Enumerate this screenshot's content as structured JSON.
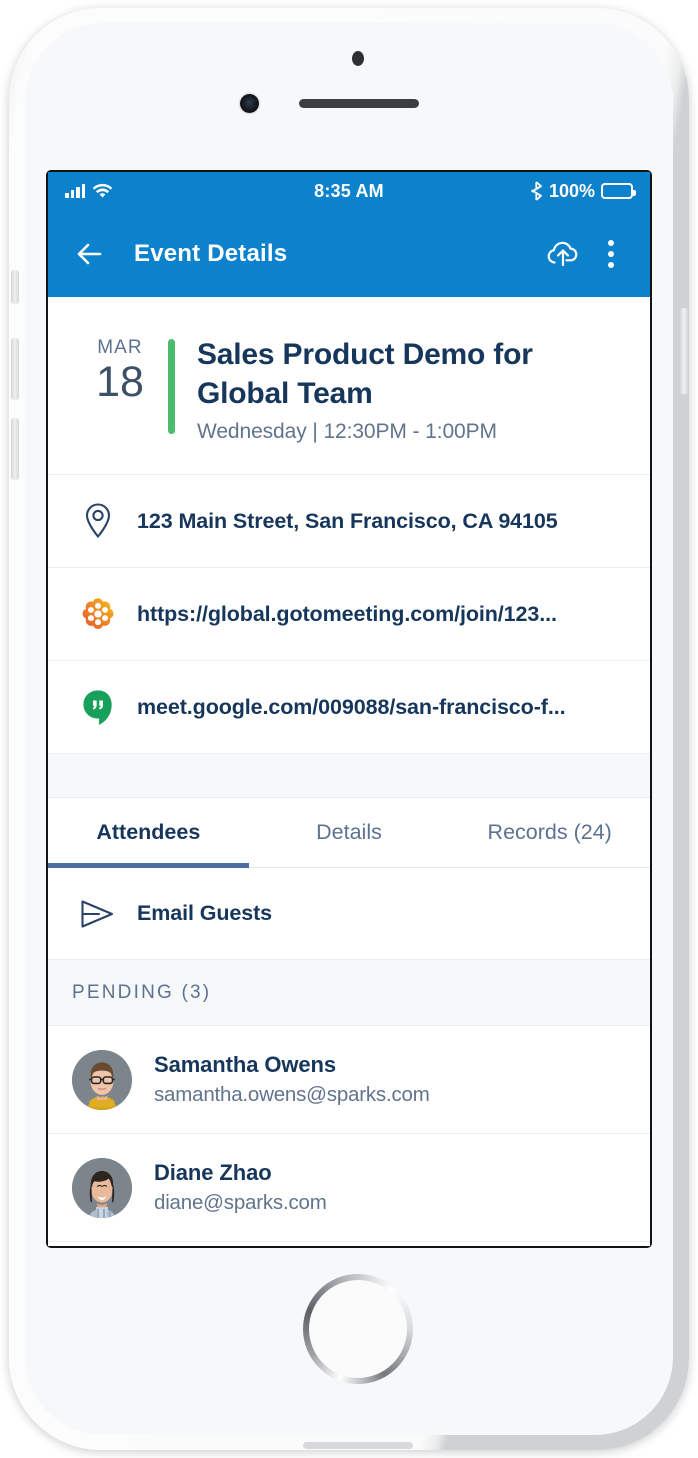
{
  "status_bar": {
    "time": "8:35 AM",
    "battery_percent": "100%",
    "signal_icon": "signal-bars-icon",
    "wifi_icon": "wifi-icon",
    "bluetooth_icon": "bluetooth-icon",
    "battery_icon": "battery-full-icon"
  },
  "app_bar": {
    "title": "Event Details",
    "back_icon": "back-arrow-icon",
    "upload_icon": "cloud-upload-icon",
    "menu_icon": "overflow-menu-icon",
    "background_color": "#0d82cc"
  },
  "event": {
    "month": "MAR",
    "day": "18",
    "title": "Sales Product Demo for Global Team",
    "subtitle": "Wednesday  |  12:30PM - 1:00PM",
    "accent_color": "#4cbb6c"
  },
  "info_rows": [
    {
      "icon": "map-pin-icon",
      "text": "123 Main Street, San Francisco, CA 94105"
    },
    {
      "icon": "gotomeeting-icon",
      "text": "https://global.gotomeeting.com/join/123..."
    },
    {
      "icon": "hangouts-icon",
      "text": "meet.google.com/009088/san-francisco-f..."
    }
  ],
  "tabs": [
    {
      "label": "Attendees",
      "active": true
    },
    {
      "label": "Details",
      "active": false
    },
    {
      "label": "Records (24)",
      "active": false
    }
  ],
  "email_guests": {
    "label": "Email Guests",
    "icon": "send-icon"
  },
  "pending_section": {
    "header": "PENDING (3)"
  },
  "attendees": [
    {
      "name": "Samantha Owens",
      "email": "samantha.owens@sparks.com",
      "avatar": "avatar-samantha"
    },
    {
      "name": "Diane Zhao",
      "email": "diane@sparks.com",
      "avatar": "avatar-diane"
    }
  ]
}
